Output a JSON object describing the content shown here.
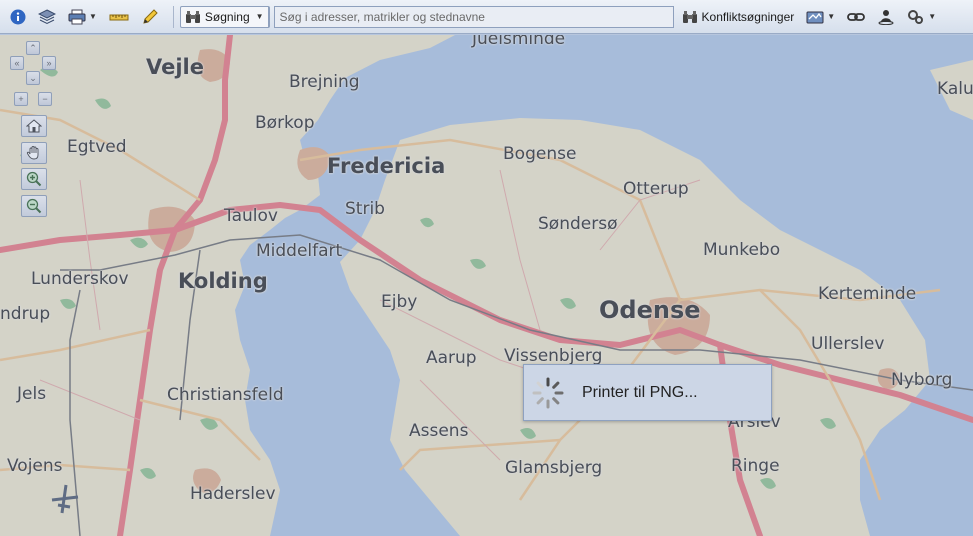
{
  "toolbar": {
    "search_menu_label": "Søgning",
    "search_placeholder": "Søg i adresser, matrikler og stednavne",
    "conflict_label": "Konfliktsøgninger"
  },
  "colors": {
    "water": "#aec4df",
    "land": "#ece3c7",
    "forest": "#8fbf8a",
    "urban": "#dfad8a",
    "motorway": "#e9747a",
    "road": "#f0c48a",
    "rail": "#6b6b6b",
    "overlay": "#96aacd"
  },
  "map": {
    "places": [
      {
        "name": "Juelsminde"
      },
      {
        "name": "Kalu"
      },
      {
        "name": "Vejle"
      },
      {
        "name": "Brejning"
      },
      {
        "name": "Børkop"
      },
      {
        "name": "Egtved"
      },
      {
        "name": "Fredericia"
      },
      {
        "name": "Bogense"
      },
      {
        "name": "Otterup"
      },
      {
        "name": "Taulov"
      },
      {
        "name": "Strib"
      },
      {
        "name": "Søndersø"
      },
      {
        "name": "Middelfart"
      },
      {
        "name": "Munkebo"
      },
      {
        "name": "Lunderskov"
      },
      {
        "name": "Kolding"
      },
      {
        "name": "Kerteminde"
      },
      {
        "name": "ndrup"
      },
      {
        "name": "Ejby"
      },
      {
        "name": "Odense"
      },
      {
        "name": "Ullerslev"
      },
      {
        "name": "Aarup"
      },
      {
        "name": "Vissenbjerg"
      },
      {
        "name": "Nyborg"
      },
      {
        "name": "Jels"
      },
      {
        "name": "Christiansfeld"
      },
      {
        "name": "Årslev"
      },
      {
        "name": "Assens"
      },
      {
        "name": "Vojens"
      },
      {
        "name": "Glamsbjerg"
      },
      {
        "name": "Ringe"
      },
      {
        "name": "Haderslev"
      }
    ]
  },
  "dialog": {
    "message": "Printer til PNG..."
  }
}
